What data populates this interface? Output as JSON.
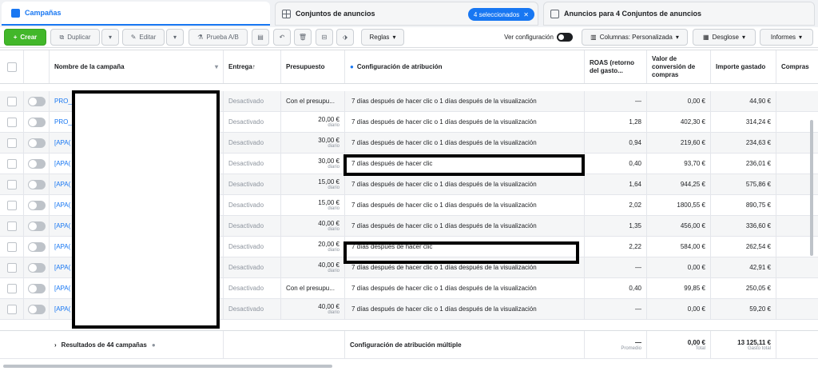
{
  "tabs": {
    "campaigns": "Campañas",
    "adsets": "Conjuntos de anuncios",
    "selected_badge": "4 seleccionados",
    "ads": "Anuncios para 4 Conjuntos de anuncios"
  },
  "toolbar": {
    "create": "Crear",
    "duplicate": "Duplicar",
    "edit": "Editar",
    "abtest": "Prueba A/B",
    "rules": "Reglas",
    "view_config": "Ver configuración",
    "columns": "Columnas: Personalizada",
    "breakdown": "Desglose",
    "reports": "Informes"
  },
  "headers": {
    "name": "Nombre de la campaña",
    "delivery": "Entrega",
    "budget": "Presupuesto",
    "attribution": "Configuración de atribución",
    "roas": "ROAS (retorno del gasto...",
    "conv_value": "Valor de conversión de compras",
    "spent": "Importe gastado",
    "purchases": "Compras"
  },
  "rows": [
    {
      "name": "PRO_",
      "delivery": "Desactivado",
      "budget": "Con el presupu...",
      "budget_sub": "",
      "attribution": "7 días después de hacer clic o 1 días después de la visualización",
      "roas": "—",
      "conv": "0,00 €",
      "spent": "44,90 €"
    },
    {
      "name": "PRO_",
      "delivery": "Desactivado",
      "budget": "20,00 €",
      "budget_sub": "diario",
      "attribution": "7 días después de hacer clic o 1 días después de la visualización",
      "roas": "1,28",
      "conv": "402,30 €",
      "spent": "314,24 €"
    },
    {
      "name": "[APA(",
      "delivery": "Desactivado",
      "budget": "30,00 €",
      "budget_sub": "diario",
      "attribution": "7 días después de hacer clic o 1 días después de la visualización",
      "roas": "0,94",
      "conv": "219,60 €",
      "spent": "234,63 €"
    },
    {
      "name": "[APA(",
      "delivery": "Desactivado",
      "budget": "30,00 €",
      "budget_sub": "diario",
      "attribution": "7 días después de hacer clic",
      "roas": "0,40",
      "conv": "93,70 €",
      "spent": "236,01 €"
    },
    {
      "name": "[APA(",
      "delivery": "Desactivado",
      "budget": "15,00 €",
      "budget_sub": "diario",
      "attribution": "7 días después de hacer clic o 1 días después de la visualización",
      "roas": "1,64",
      "conv": "944,25 €",
      "spent": "575,86 €"
    },
    {
      "name": "[APA(",
      "delivery": "Desactivado",
      "budget": "15,00 €",
      "budget_sub": "diario",
      "attribution": "7 días después de hacer clic o 1 días después de la visualización",
      "roas": "2,02",
      "conv": "1800,55 €",
      "spent": "890,75 €"
    },
    {
      "name": "[APA(",
      "delivery": "Desactivado",
      "budget": "40,00 €",
      "budget_sub": "diario",
      "attribution": "7 días después de hacer clic o 1 días después de la visualización",
      "roas": "1,35",
      "conv": "456,00 €",
      "spent": "336,60 €"
    },
    {
      "name": "[APA(",
      "delivery": "Desactivado",
      "budget": "20,00 €",
      "budget_sub": "diario",
      "attribution": "7 días después de hacer clic",
      "roas": "2,22",
      "conv": "584,00 €",
      "spent": "262,54 €"
    },
    {
      "name": "[APA(",
      "delivery": "Desactivado",
      "budget": "40,00 €",
      "budget_sub": "diario",
      "attribution": "7 días después de hacer clic o 1 días después de la visualización",
      "roas": "—",
      "conv": "0,00 €",
      "spent": "42,91 €"
    },
    {
      "name": "[APA(",
      "delivery": "Desactivado",
      "budget": "Con el presupu...",
      "budget_sub": "",
      "attribution": "7 días después de hacer clic o 1 días después de la visualización",
      "roas": "0,40",
      "conv": "99,85 €",
      "spent": "250,05 €"
    },
    {
      "name": "[APA(",
      "delivery": "Desactivado",
      "budget": "40,00 €",
      "budget_sub": "diario",
      "attribution": "7 días después de hacer clic o 1 días después de la visualización",
      "roas": "—",
      "conv": "0,00 €",
      "spent": "59,20 €"
    }
  ],
  "footer": {
    "results": "Resultados de 44 campañas",
    "attribution": "Configuración de atribución múltiple",
    "roas": "—",
    "roas_sub": "Promedio",
    "conv": "0,00 €",
    "conv_sub": "Total",
    "spent": "13 125,11 €",
    "spent_sub": "Gasto total"
  },
  "colors": {
    "accent": "#1877f2",
    "create": "#42b72a"
  }
}
